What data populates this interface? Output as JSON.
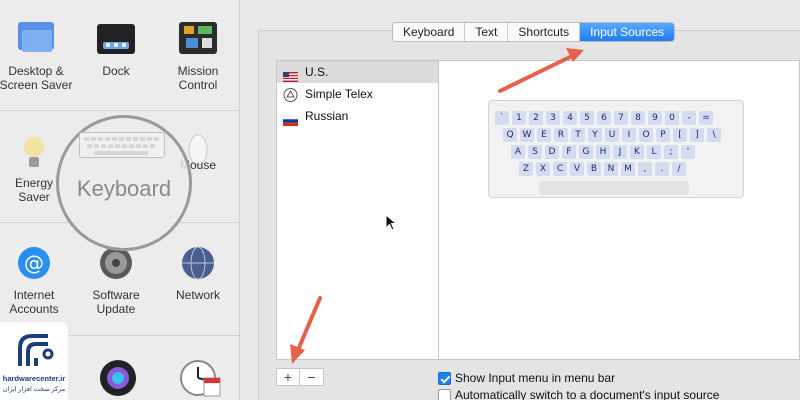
{
  "left_panel": {
    "row1": [
      {
        "label": "Desktop &\nScreen Saver",
        "icon": "desktop-screensaver-icon"
      },
      {
        "label": "Dock",
        "icon": "dock-icon"
      },
      {
        "label": "Mission\nControl",
        "icon": "mission-control-icon"
      }
    ],
    "row2": [
      {
        "label": "Energy\nSaver",
        "icon": "lightbulb-icon"
      },
      {
        "label": "Keyboard",
        "icon": "keyboard-icon"
      },
      {
        "label": "Mouse",
        "icon": "mouse-icon"
      }
    ],
    "row3": [
      {
        "label": "Internet\nAccounts",
        "icon": "at-sign-icon"
      },
      {
        "label": "Software\nUpdate",
        "icon": "gear-icon"
      },
      {
        "label": "Network",
        "icon": "globe-icon"
      }
    ]
  },
  "tabs": [
    "Keyboard",
    "Text",
    "Shortcuts",
    "Input Sources"
  ],
  "active_tab": "Input Sources",
  "input_sources": [
    {
      "label": "U.S.",
      "flag": "us-flag-icon",
      "selected": true
    },
    {
      "label": "Simple Telex",
      "flag": "simple-telex-icon",
      "selected": false
    },
    {
      "label": "Russian",
      "flag": "russia-flag-icon",
      "selected": false
    }
  ],
  "keyboard_rows": [
    [
      "`",
      "1",
      "2",
      "3",
      "4",
      "5",
      "6",
      "7",
      "8",
      "9",
      "0",
      "-",
      "="
    ],
    [
      "Q",
      "W",
      "E",
      "R",
      "T",
      "Y",
      "U",
      "I",
      "O",
      "P",
      "[",
      "]",
      "\\"
    ],
    [
      "A",
      "S",
      "D",
      "F",
      "G",
      "H",
      "J",
      "K",
      "L",
      ";",
      "'"
    ],
    [
      "Z",
      "X",
      "C",
      "V",
      "B",
      "N",
      "M",
      ",",
      ".",
      "/"
    ]
  ],
  "buttons": {
    "add": "+",
    "remove": "−"
  },
  "checkboxes": [
    {
      "label": "Show Input menu in menu bar",
      "checked": true
    },
    {
      "label": "Automatically switch to a document's input source",
      "checked": false
    }
  ],
  "logo": {
    "line1": "hardwarecenter.ir",
    "line2": "مرکز سخت افزار ایران"
  },
  "colors": {
    "accent": "#1e7cf2",
    "arrow": "#e2624a"
  }
}
